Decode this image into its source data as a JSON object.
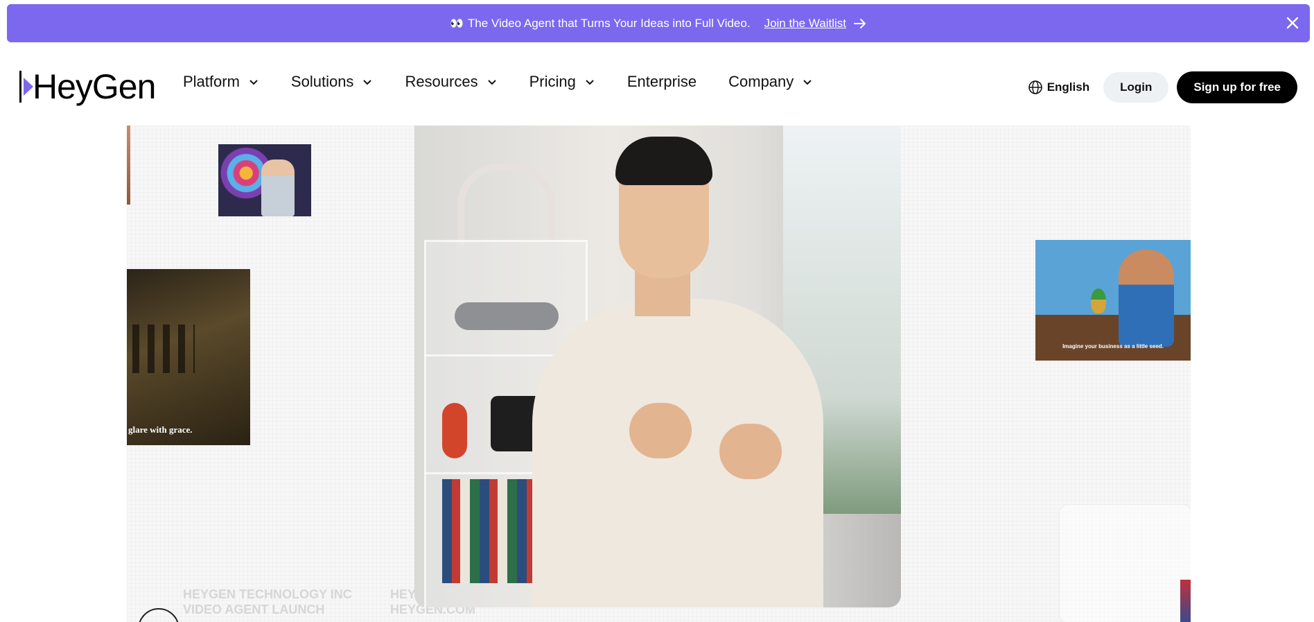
{
  "banner": {
    "emoji": "👀",
    "text": "The Video Agent that Turns Your Ideas into Full Video.",
    "link_label": "Join the Waitlist",
    "arrow_icon": "arrow-right-icon",
    "close_icon": "close-icon"
  },
  "brand": {
    "logo_text": "HeyGen",
    "accent_color": "#7b68ee"
  },
  "nav": {
    "items": [
      {
        "label": "Platform",
        "has_dropdown": true
      },
      {
        "label": "Solutions",
        "has_dropdown": true
      },
      {
        "label": "Resources",
        "has_dropdown": true
      },
      {
        "label": "Pricing",
        "has_dropdown": true
      },
      {
        "label": "Enterprise",
        "has_dropdown": false
      },
      {
        "label": "Company",
        "has_dropdown": true
      }
    ],
    "language": {
      "label": "English",
      "icon": "globe-icon"
    },
    "login_label": "Login",
    "signup_label": "Sign up for free"
  },
  "hero": {
    "field_caption": "glare with grace.",
    "seed_caption": "Imagine your business as a little seed.",
    "ghost_text_left": [
      "HEYGEN TECHNOLOGY INC",
      "VIDEO AGENT LAUNCH"
    ],
    "ghost_text_right": [
      "HEY",
      "HEYGEN.COM"
    ]
  }
}
